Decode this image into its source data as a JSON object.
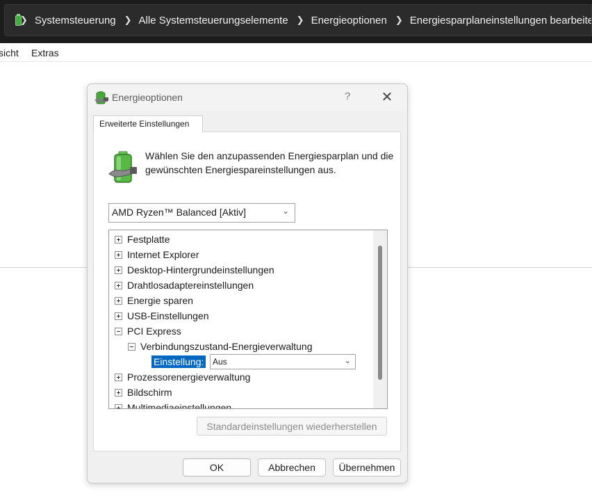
{
  "address_bar": {
    "breadcrumbs": [
      "Systemsteuerung",
      "Alle Systemsteuerungselemente",
      "Energieoptionen",
      "Energiesparplaneinstellungen bearbeiten"
    ]
  },
  "menu": {
    "items": [
      "sicht",
      "Extras"
    ]
  },
  "dialog": {
    "title": "Energieoptionen",
    "help": "?",
    "close": "✕",
    "tab": "Erweiterte Einstellungen",
    "intro": "Wählen Sie den anzupassenden Energiesparplan und die gewünschten Energiespareinstellungen aus.",
    "plan_select": "AMD Ryzen™ Balanced [Aktiv]",
    "tree": {
      "items": [
        "Festplatte",
        "Internet Explorer",
        "Desktop-Hintergrundeinstellungen",
        "Drahtlosadaptereinstellungen",
        "Energie sparen",
        "USB-Einstellungen",
        "PCI Express",
        "Verbindungszustand-Energieverwaltung",
        "Prozessorenergieverwaltung",
        "Bildschirm",
        "Multimediaeinstellungen"
      ],
      "setting_label": "Einstellung:",
      "setting_value": "Aus"
    },
    "restore_button": "Standardeinstellungen wiederherstellen",
    "ok_button": "OK",
    "cancel_button": "Abbrechen",
    "apply_button": "Übernehmen"
  }
}
